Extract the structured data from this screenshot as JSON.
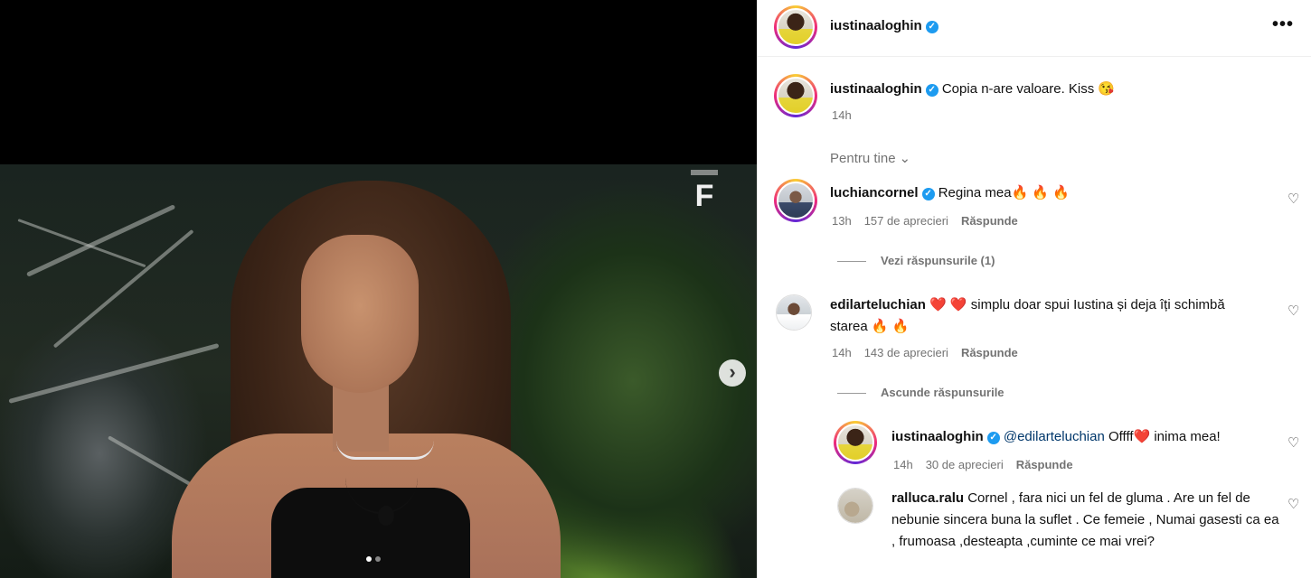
{
  "post": {
    "author": "iustinaaloghin",
    "caption": "Copia n-are valoare. Kiss 😘",
    "time": "14h",
    "carousel_total": 2,
    "carousel_current": 1
  },
  "header": {
    "username": "iustinaaloghin",
    "more_icon": "•••"
  },
  "filter": {
    "label": "Pentru tine",
    "chevron": "⌄"
  },
  "comments": [
    {
      "user": "luchiancornel",
      "verified": true,
      "text": "Regina mea🔥 🔥 🔥",
      "time": "13h",
      "likes": "157 de aprecieri",
      "reply": "Răspunde",
      "thread_toggle": "Vezi răspunsurile (1)"
    },
    {
      "user": "edilarteluchian",
      "verified": false,
      "text": "❤️ ❤️ simplu doar spui Iustina și deja îți schimbă starea 🔥 🔥",
      "time": "14h",
      "likes": "143 de aprecieri",
      "reply": "Răspunde",
      "thread_toggle": "Ascunde răspunsurile"
    }
  ],
  "replies": [
    {
      "user": "iustinaaloghin",
      "verified": true,
      "mention": "@edilarteluchian",
      "text": "Offff❤️  inima mea!",
      "time": "14h",
      "likes": "30 de aprecieri",
      "reply": "Răspunde"
    },
    {
      "user": "ralluca.ralu",
      "verified": false,
      "text": "Cornel , fara nici un fel de gluma . Are un fel de nebunie sincera buna la suflet . Ce femeie , Numai gasesti ca ea , frumoasa ,desteapta ,cuminte ce mai vrei?"
    }
  ],
  "icons": {
    "heart": "♡",
    "next": "›",
    "verified": "✓"
  },
  "colors": {
    "verified": "#1d9bf0",
    "meta": "#737373",
    "mention": "#00376b"
  }
}
